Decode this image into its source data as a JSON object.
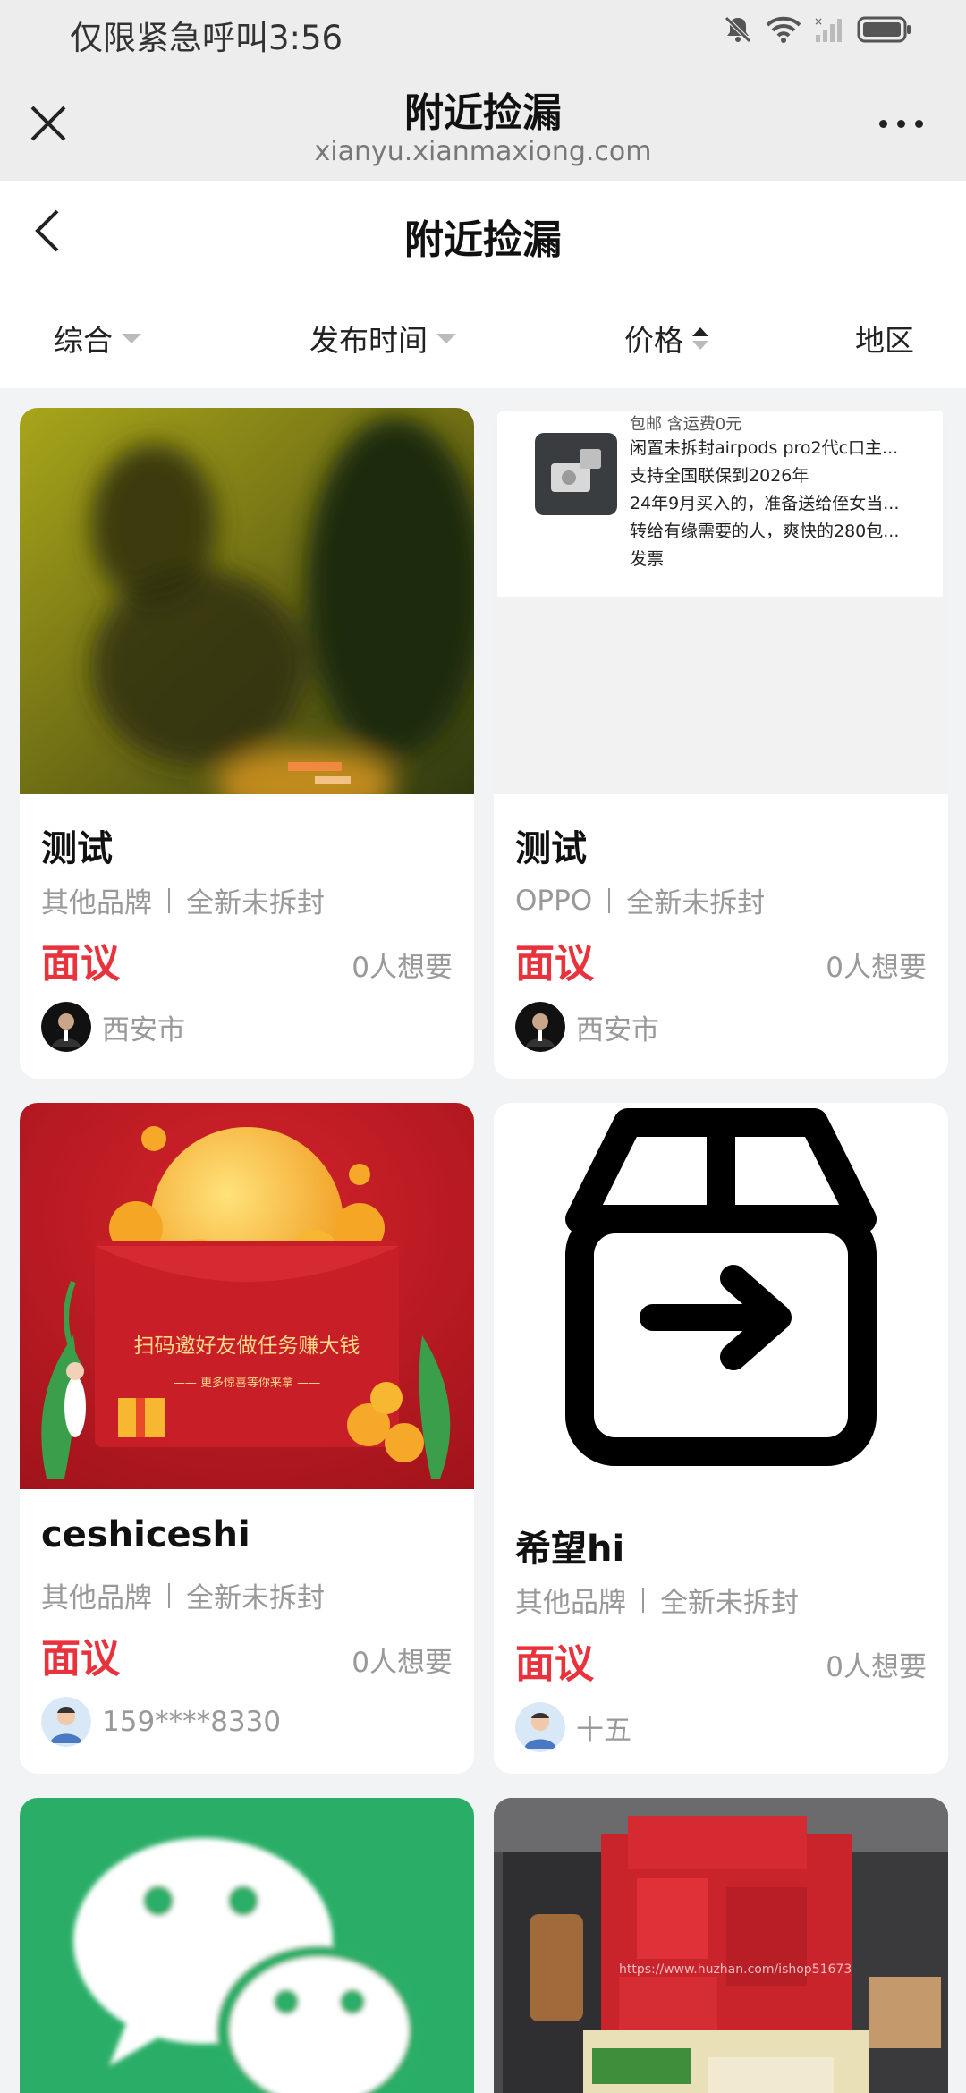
{
  "status_bar": {
    "carrier": "仅限紧急呼叫",
    "time": "3:56"
  },
  "browser": {
    "title": "附近捡漏",
    "url": "xianyu.xianmaxiong.com"
  },
  "header": {
    "title": "附近捡漏"
  },
  "filters": [
    "综合",
    "发布时间",
    "价格",
    "地区"
  ],
  "products": [
    {
      "title": "测试",
      "brand": "其他品牌",
      "condition": "全新未拆封",
      "price": "面议",
      "want": "0人想要",
      "seller": "西安市"
    },
    {
      "title": "测试",
      "brand": "OPPO",
      "condition": "全新未拆封",
      "price": "面议",
      "want": "0人想要",
      "seller": "西安市",
      "preview": {
        "small": "包邮    含运费0元",
        "lines": [
          "闲置未拆封airpods pro2代c口主...",
          "支持全国联保到2026年",
          "24年9月买入的，准备送给侄女当...",
          "转给有缘需要的人，爽快的280包...",
          "发票"
        ]
      }
    },
    {
      "title": "ceshiceshi",
      "brand": "其他品牌",
      "condition": "全新未拆封",
      "price": "面议",
      "want": "0人想要",
      "seller": "159****8330",
      "banner": {
        "main": "扫码邀好友做任务赚大钱",
        "sub": "—— 更多惊喜等你来拿 ——"
      }
    },
    {
      "title": "希望hi",
      "brand": "其他品牌",
      "condition": "全新未拆封",
      "price": "面议",
      "want": "0人想要",
      "seller": "十五"
    }
  ],
  "colors": {
    "price": "#e8323c",
    "wechat_green": "#2aae67"
  }
}
